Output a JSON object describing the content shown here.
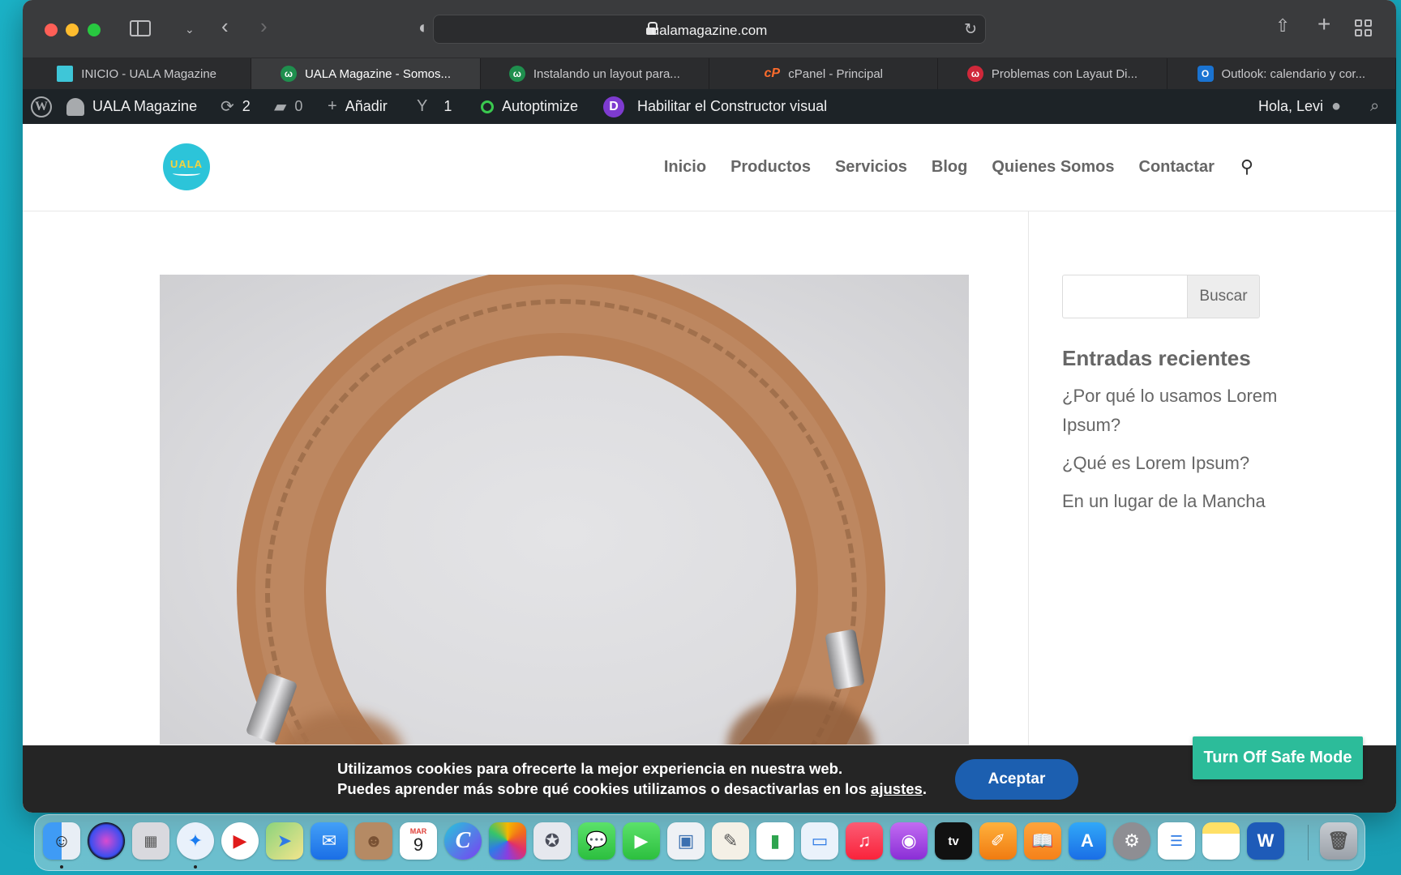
{
  "browser": {
    "url": "ualamagazine.com",
    "tabs": [
      {
        "label": "INICIO - UALA Magazine",
        "icon": "uala-favicon",
        "active": false
      },
      {
        "label": "UALA Magazine - Somos...",
        "icon": "w-favicon",
        "active": true
      },
      {
        "label": "Instalando un layout para...",
        "icon": "w-favicon",
        "active": false
      },
      {
        "label": "cPanel - Principal",
        "icon": "cpanel-favicon",
        "active": false
      },
      {
        "label": "Problemas con Layaut Di...",
        "icon": "red-w-favicon",
        "active": false
      },
      {
        "label": "Outlook: calendario y cor...",
        "icon": "outlook-favicon",
        "active": false
      }
    ]
  },
  "adminbar": {
    "site_name": "UALA Magazine",
    "updates_count": "2",
    "comments_count": "0",
    "add_label": "Añadir",
    "yoast_count": "1",
    "autoptimize_label": "Autoptimize",
    "divi_label": "Habilitar el Constructor visual",
    "greeting": "Hola, Levi"
  },
  "site": {
    "logo_text": "UALA",
    "nav": [
      "Inicio",
      "Productos",
      "Servicios",
      "Blog",
      "Quienes Somos",
      "Contactar"
    ]
  },
  "sidebar": {
    "search_placeholder": "",
    "search_button": "Buscar",
    "recent_title": "Entradas recientes",
    "recent_posts": [
      "¿Por qué lo usamos Lorem Ipsum?",
      "¿Qué es Lorem Ipsum?",
      "En un lugar de la Mancha"
    ]
  },
  "cookie": {
    "line1": "Utilizamos cookies para ofrecerte la mejor experiencia en nuestra web.",
    "line2_prefix": "Puedes aprender más sobre qué cookies utilizamos o desactivarlas en los ",
    "link": "ajustes",
    "line2_suffix": ".",
    "accept": "Aceptar"
  },
  "safe_mode_button": "Turn Off Safe Mode",
  "dock": {
    "calendar_month": "MAR",
    "calendar_day": "9",
    "apps": [
      "finder-icon",
      "siri-icon",
      "launchpad-icon",
      "safari-icon",
      "youtube-icon",
      "maps-icon",
      "mail-icon",
      "contacts-icon",
      "calendar-icon",
      "canva-icon",
      "photos-icon",
      "instruments-icon",
      "messages-icon",
      "facetime-icon",
      "preview-icon",
      "textedit-icon",
      "numbers-icon",
      "keynote-icon",
      "music-icon",
      "podcasts-icon",
      "appletv-icon",
      "pages-icon",
      "books-icon",
      "appstore-icon",
      "system-preferences-icon",
      "reminders-icon",
      "notes-icon",
      "word-icon",
      "trash-icon"
    ]
  }
}
